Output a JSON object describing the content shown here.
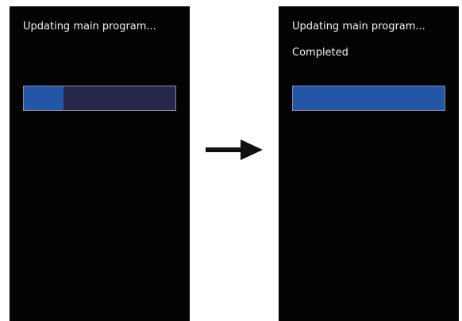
{
  "left_screen": {
    "status": "Updating main program...",
    "progress": 0.26
  },
  "right_screen": {
    "status": "Updating main program...",
    "completion": "Completed",
    "progress": 1.0
  },
  "transition_icon": "right-arrow-icon",
  "colors": {
    "screen_bg": "#030303",
    "text": "#f2f2f2",
    "progress_fill": "#2456a8",
    "progress_track": "#27274a",
    "progress_border": "#8c8ca4",
    "arrow": "#111111"
  }
}
